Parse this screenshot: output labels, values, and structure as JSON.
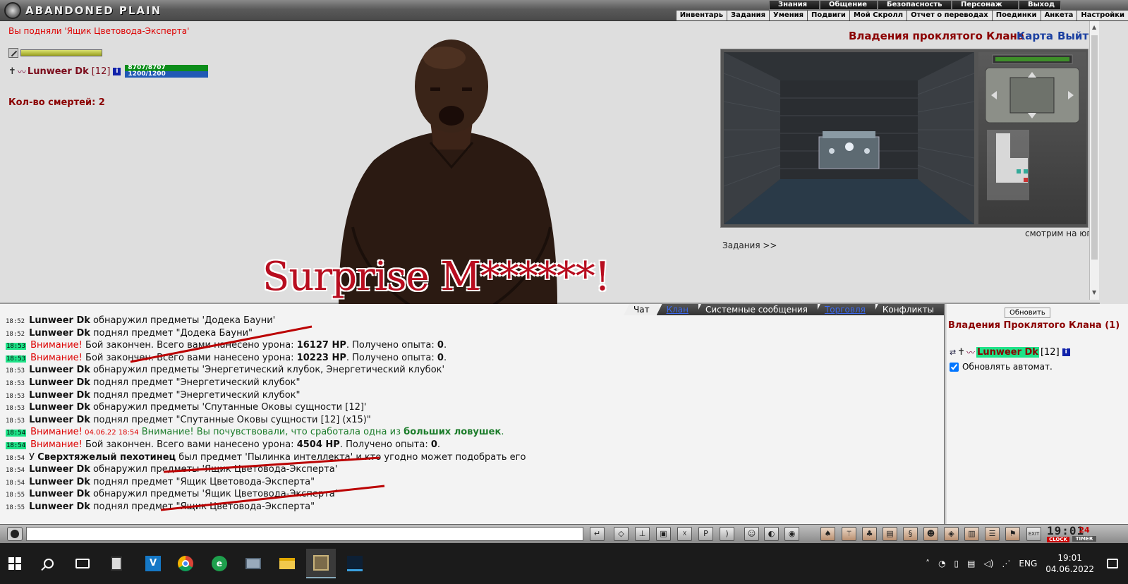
{
  "topbar": {
    "logo_text": "ABANDONED PLAIN",
    "menu_primary": [
      "Знания",
      "Общение",
      "Безопасность",
      "Персонаж",
      "Выход"
    ],
    "menu_secondary": [
      "Инвентарь",
      "Задания",
      "Умения",
      "Подвиги",
      "Мой Скролл",
      "Отчет о переводах",
      "Поединки",
      "Анкета",
      "Настройки"
    ]
  },
  "game": {
    "pickup_message": "Вы подняли 'Ящик Цветовода-Эксперта'",
    "character": {
      "name": "Lunweer Dk",
      "level": "[12]",
      "hp_text": "8707/8707",
      "mp_text": "1200/1200"
    },
    "deaths_label": "Кол-во смертей: 2",
    "meme_caption": "Surprise M******!",
    "location_title": "Владения проклятого Клана",
    "map_link": "Карта",
    "exit_link": "Выйти",
    "looking_direction": "смотрим на юг",
    "tasks_link": "Задания >>"
  },
  "chat": {
    "tabs": [
      "Чат",
      "Клан",
      "Системные сообщения",
      "Торговля",
      "Конфликты"
    ],
    "lines": [
      {
        "time": "18:52",
        "who": "Lunweer Dk",
        "text": " обнаружил предметы 'Додека Бауни'"
      },
      {
        "time": "18:52",
        "who": "Lunweer Dk",
        "text": " поднял предмет \"Додека Бауни\""
      },
      {
        "time": "18:53",
        "warn": "Внимание!",
        "text": " Бой закончен. Всего вами нанесено урона: ",
        "b1": "16127 HP",
        "text2": ". Получено опыта: ",
        "b2": "0",
        "text3": "."
      },
      {
        "time": "18:53",
        "warn": "Внимание!",
        "text": " Бой закончен. Всего вами нанесено урона: ",
        "b1": "10223 HP",
        "text2": ". Получено опыта: ",
        "b2": "0",
        "text3": "."
      },
      {
        "time": "18:53",
        "who": "Lunweer Dk",
        "text": " обнаружил предметы 'Энергетический клубок, Энергетический клубок'"
      },
      {
        "time": "18:53",
        "who": "Lunweer Dk",
        "text": " поднял предмет \"Энергетический клубок\""
      },
      {
        "time": "18:53",
        "who": "Lunweer Dk",
        "text": " поднял предмет \"Энергетический клубок\""
      },
      {
        "time": "18:53",
        "who": "Lunweer Dk",
        "text": " обнаружил предметы 'Спутанные Оковы сущности [12]'"
      },
      {
        "time": "18:53",
        "who": "Lunweer Dk",
        "text": " поднял предмет \"Спутанные Оковы сущности [12] (x15)\""
      },
      {
        "time": "18:54",
        "warn": "Внимание!",
        "date": " 04.06.22 18:54",
        "trap": " Внимание! Вы почувствовали, что сработала одна из ",
        "trapbold": "больших ловушек",
        "trapend": "."
      },
      {
        "time": "18:54",
        "warn": "Внимание!",
        "text": " Бой закончен. Всего вами нанесено урона: ",
        "b1": "4504 HP",
        "text2": ". Получено опыта: ",
        "b2": "0",
        "text3": "."
      },
      {
        "time": "18:54",
        "pre": "У ",
        "who": "Сверхтяжелый пехотинец",
        "text": " был предмет 'Пылинка интеллекта' и кто угодно может подобрать его"
      },
      {
        "time": "18:54",
        "who": "Lunweer Dk",
        "text": " обнаружил предметы 'Ящик Цветовода-Эксперта'"
      },
      {
        "time": "18:54",
        "who": "Lunweer Dk",
        "text": " поднял предмет \"Ящик Цветовода-Эксперта\""
      },
      {
        "time": "18:55",
        "who": "Lunweer Dk",
        "text": " обнаружил предметы 'Ящик Цветовода-Эксперта'"
      },
      {
        "time": "18:55",
        "who": "Lunweer Dk",
        "text": " поднял предмет \"Ящик Цветовода-Эксперта\""
      }
    ]
  },
  "side": {
    "refresh_label": "Обновить",
    "title": "Владения Проклятого Клана (1)",
    "member_name": "Lunweer Dk",
    "member_level": "[12]",
    "auto_refresh_label": "Обновлять автомат."
  },
  "toolbar": {
    "clock_time": "19:01",
    "clock_label": "CLOCK",
    "timer_value": "24",
    "timer_label": "TIMER"
  },
  "taskbar": {
    "lang": "ENG",
    "time": "19:01",
    "date": "04.06.2022",
    "vs_badge": "V"
  }
}
